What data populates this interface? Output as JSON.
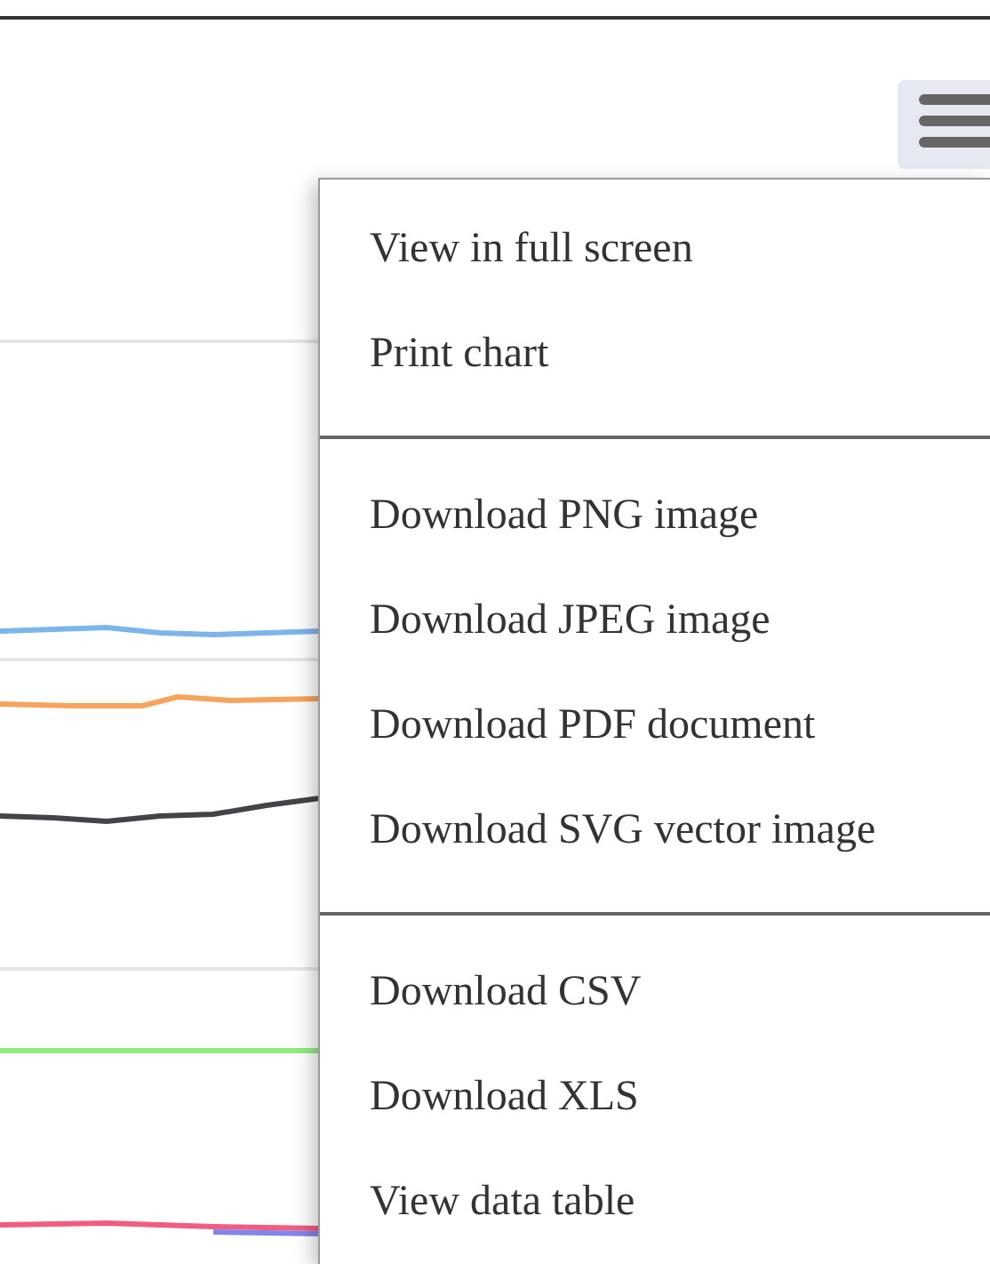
{
  "export_menu": {
    "groups": [
      {
        "items": [
          {
            "label": "View in full screen"
          },
          {
            "label": "Print chart"
          }
        ]
      },
      {
        "items": [
          {
            "label": "Download PNG image"
          },
          {
            "label": "Download JPEG image"
          },
          {
            "label": "Download PDF document"
          },
          {
            "label": "Download SVG vector image"
          }
        ]
      },
      {
        "items": [
          {
            "label": "Download CSV"
          },
          {
            "label": "Download XLS"
          },
          {
            "label": "View data table"
          }
        ]
      }
    ]
  }
}
